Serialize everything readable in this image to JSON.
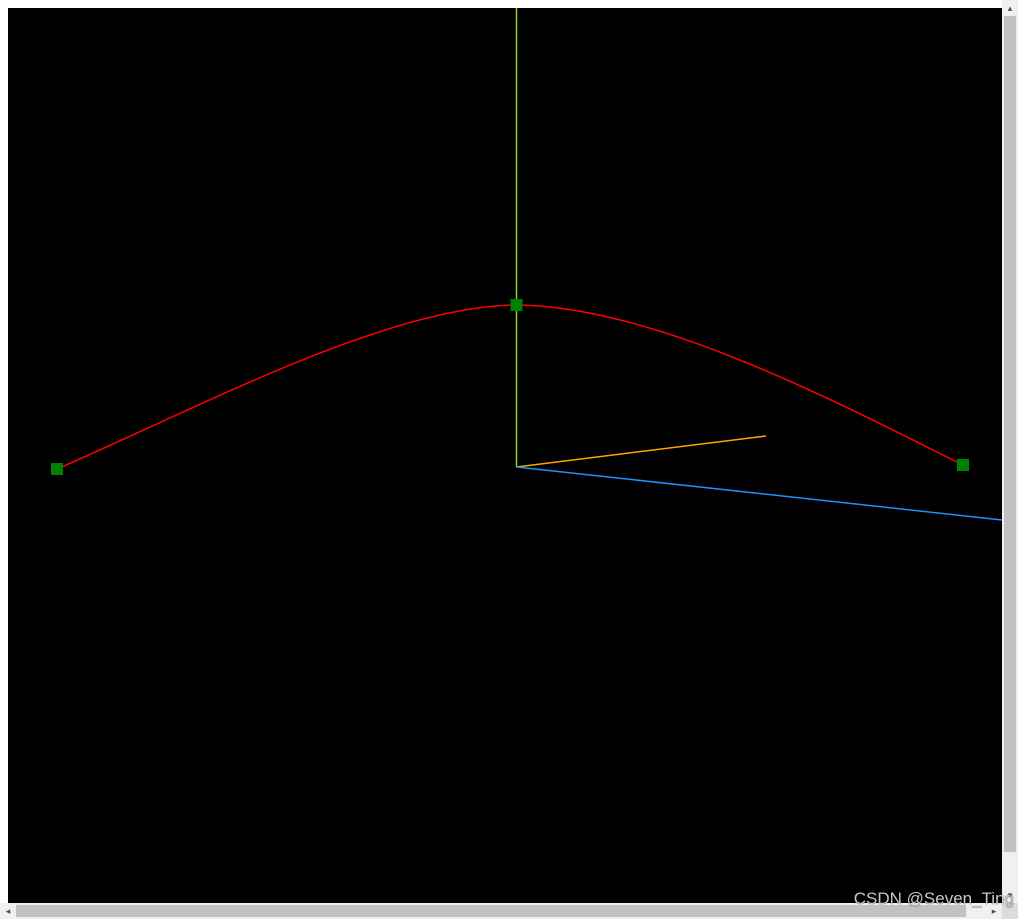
{
  "scene": {
    "background_color": "#000000",
    "curve_color": "#ff0000",
    "control_point_color": "#008000",
    "axis_colors": {
      "y_axis": "#9acd32",
      "x_axis": "#1e90ff",
      "z_axis": "#ffa500"
    }
  },
  "watermark": {
    "text": "CSDN @Seven_Ting"
  },
  "scrollbars": {
    "vertical_up_glyph": "▴",
    "vertical_down_glyph": "▾",
    "horizontal_left_glyph": "◂",
    "horizontal_right_glyph": "▸"
  }
}
